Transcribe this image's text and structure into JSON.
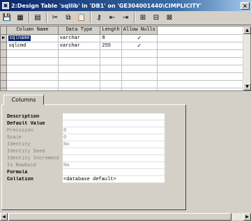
{
  "window": {
    "title": "2:Design Table 'sqllib' in 'DB1' on 'GE304001440\\CIMPLICITY'",
    "close_label": "×",
    "maximize_label": "□",
    "minimize_label": "_"
  },
  "toolbar": {
    "icons": [
      "save-icon",
      "properties-icon",
      "manage-icon",
      "cut-icon",
      "copy-icon",
      "paste-icon",
      "set-primary-key-icon",
      "insert-column-icon",
      "delete-column-icon",
      "relationships-icon",
      "indexes-icon",
      "constraints-icon"
    ],
    "glyphs": {
      "save": "💾",
      "props": "▦",
      "manage": "▤",
      "cut": "✂",
      "copy": "⧉",
      "paste": "📋",
      "key": "⚷",
      "insert": "⇤",
      "delete": "⇥",
      "rel": "⊞",
      "idx": "⊟",
      "cons": "⊠"
    }
  },
  "grid": {
    "columns": [
      "Column Name",
      "Data Type",
      "Length",
      "Allow Nulls"
    ],
    "rows": [
      {
        "marker": "▶",
        "name": "sqlname",
        "type": "varchar",
        "length": "8",
        "nulls": "✓"
      },
      {
        "marker": "",
        "name": "sqlcmd",
        "type": "varchar",
        "length": "255",
        "nulls": "✓"
      }
    ]
  },
  "tab": {
    "label": "Columns"
  },
  "properties": {
    "description": {
      "label": "Description",
      "value": ""
    },
    "default_value": {
      "label": "Default Value",
      "value": ""
    },
    "precision": {
      "label": "Precision",
      "value": "0"
    },
    "scale": {
      "label": "Scale",
      "value": "0"
    },
    "identity": {
      "label": "Identity",
      "value": "No"
    },
    "identity_seed": {
      "label": "Identity Seed",
      "value": ""
    },
    "identity_increment": {
      "label": "Identity Increment",
      "value": ""
    },
    "is_rowguid": {
      "label": "Is RowGuid",
      "value": "No"
    },
    "formula": {
      "label": "Formula",
      "value": ""
    },
    "collation": {
      "label": "Collation",
      "value": "<database default>"
    }
  },
  "scroll": {
    "up": "▲",
    "down": "▼",
    "left": "◀",
    "right": "▶"
  }
}
